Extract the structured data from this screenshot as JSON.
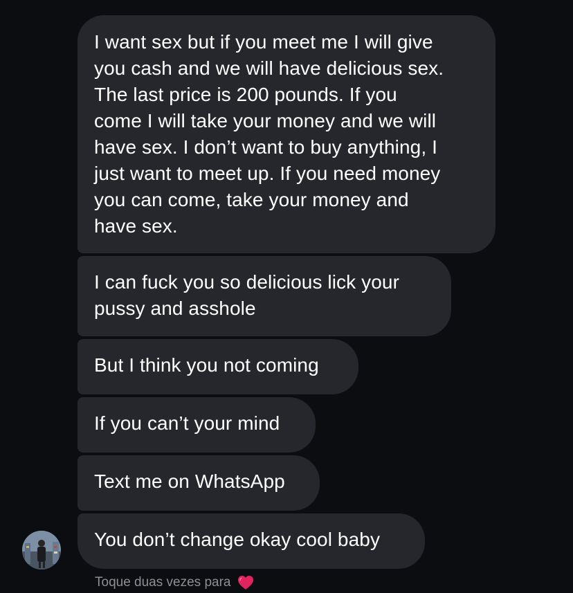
{
  "messages": [
    {
      "text": "I want sex but if you meet me I will give\nyou cash and we will have delicious sex.\nThe last price is 200 pounds. If you\ncome I will take your money and we will\nhave sex. I don’t want to buy anything, I\njust want to meet up. If you need money\nyou can come, take your money and\nhave sex."
    },
    {
      "text": "I can fuck you so delicious lick your\npussy and asshole"
    },
    {
      "text": "But I think you not coming"
    },
    {
      "text": "If you can’t your mind"
    },
    {
      "text": "Text me on WhatsApp"
    },
    {
      "text": "You don’t change okay cool baby"
    }
  ],
  "footer": {
    "hint_text": "Toque duas vezes para",
    "heart_icon": "red-heart-icon",
    "heart_color": "#e0245e"
  },
  "colors": {
    "background": "#0c0d11",
    "bubble": "#25272d",
    "text": "#ffffff",
    "hint": "#8e8f94"
  }
}
